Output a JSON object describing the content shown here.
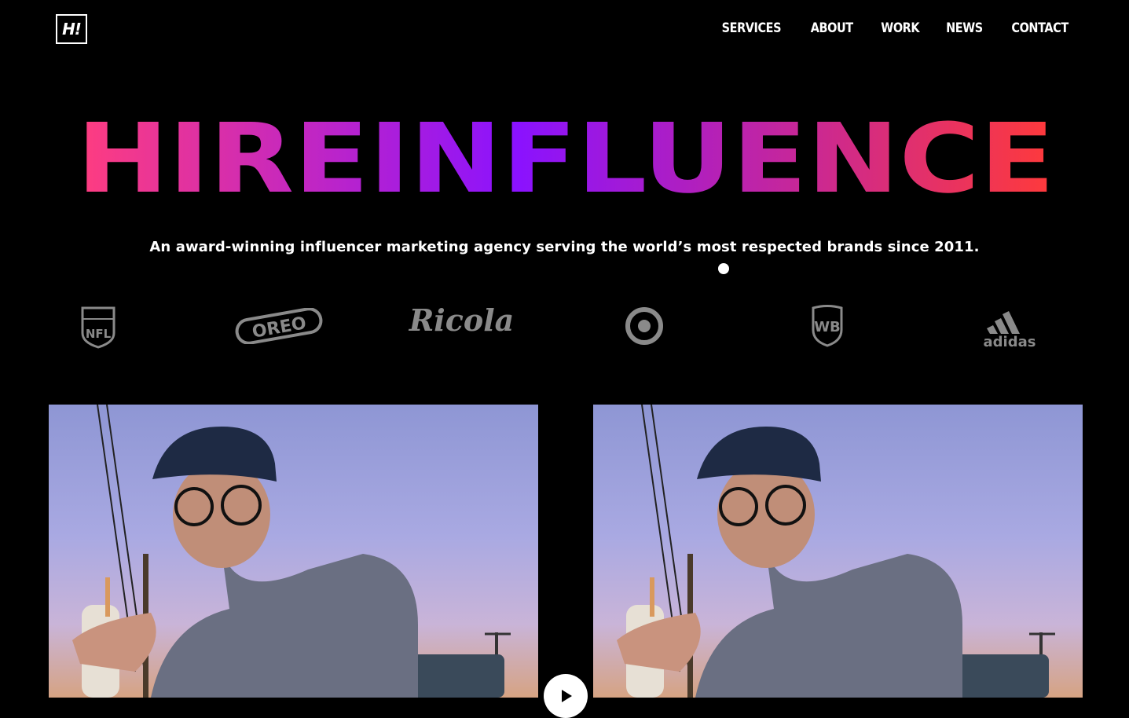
{
  "header": {
    "logo_text": "H!",
    "nav": [
      "SERVICES",
      "ABOUT",
      "WORK",
      "NEWS",
      "CONTACT"
    ]
  },
  "hero": {
    "title": "HIREINFLUENCE",
    "tagline": "An award-winning influencer marketing agency serving the world’s most respected brands since 2011.",
    "gradient": [
      "#ff3d7f",
      "#8a12ff",
      "#ff3a3a"
    ]
  },
  "brands": [
    {
      "name": "NFL",
      "icon": "nfl-logo-icon"
    },
    {
      "name": "OREO",
      "icon": "oreo-logo-icon"
    },
    {
      "name": "Ricola",
      "icon": "ricola-logo-icon"
    },
    {
      "name": "Target",
      "icon": "target-logo-icon"
    },
    {
      "name": "WB",
      "icon": "wb-logo-icon"
    },
    {
      "name": "adidas",
      "icon": "adidas-logo-icon"
    }
  ],
  "colors": {
    "background": "#000000",
    "brand_gray": "#8a8a8a"
  },
  "videos": [
    {
      "icon": "video-thumbnail"
    },
    {
      "icon": "video-thumbnail"
    }
  ]
}
